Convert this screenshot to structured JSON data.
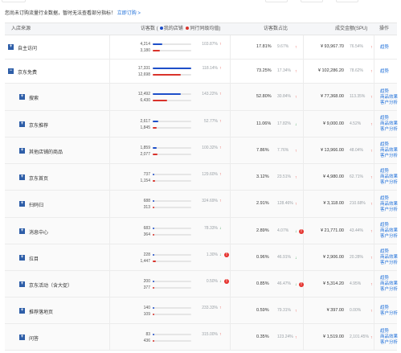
{
  "notice": {
    "text": "您尚未订购流量行业数据，暂时无法查看部分指标！",
    "link": "立即订购 >"
  },
  "colors": {
    "mine": "#1e4fc9",
    "peer": "#d9332b",
    "link": "#1e6fd9",
    "up": "#e5322d",
    "down": "#2b9a4a"
  },
  "header": {
    "source": "入店来源",
    "visitors": "访客数",
    "legend_mine": "我的店铺",
    "legend_peer": "同行同级均值",
    "share": "访客数占比",
    "amount": "成交金额(SPU)",
    "op": "操作"
  },
  "rows": [
    {
      "name": "自主访问",
      "level": 1,
      "expand": "+",
      "mine": "4,214",
      "mine_frac": 0.24,
      "peer": "3,180",
      "peer_frac": 0.18,
      "change": "103.87%",
      "dir": "up",
      "share": "17.81%",
      "share_sub": "9.67%",
      "share_dir": "up",
      "amount": "¥ 93,967.70",
      "amount_sub": "76.54%",
      "amount_dir": "up",
      "ops": [
        "趋势"
      ]
    },
    {
      "name": "京东免费",
      "level": 1,
      "expand": "−",
      "mine": "17,331",
      "mine_frac": 1.0,
      "peer": "12,698",
      "peer_frac": 0.73,
      "change": "118.14%",
      "dir": "up",
      "share": "73.25%",
      "share_sub": "17.34%",
      "share_dir": "up",
      "amount": "¥ 102,286.20",
      "amount_sub": "78.62%",
      "amount_dir": "up",
      "ops": [
        "趋势"
      ]
    },
    {
      "name": "搜索",
      "level": 2,
      "expand": "+",
      "mine": "12,492",
      "mine_frac": 0.72,
      "peer": "6,430",
      "peer_frac": 0.37,
      "change": "143.22%",
      "dir": "up",
      "share": "52.80%",
      "share_sub": "30.84%",
      "share_dir": "up",
      "amount": "¥ 77,368.00",
      "amount_sub": "113.35%",
      "amount_dir": "up",
      "ops": [
        "趋势",
        "商品效果",
        "客户分析"
      ]
    },
    {
      "name": "京东推荐",
      "level": 2,
      "expand": "+",
      "mine": "2,617",
      "mine_frac": 0.15,
      "peer": "1,845",
      "peer_frac": 0.11,
      "change": "52.77%",
      "dir": "up",
      "share": "11.06%",
      "share_sub": "17.82%",
      "share_dir": "down",
      "amount": "¥ 9,000.00",
      "amount_sub": "4.52%",
      "amount_dir": "up",
      "ops": [
        "趋势",
        "商品效果",
        "客户分析"
      ]
    },
    {
      "name": "其他店铺的商品",
      "level": 2,
      "expand": "+",
      "mine": "1,859",
      "mine_frac": 0.11,
      "peer": "2,077",
      "peer_frac": 0.12,
      "change": "100.32%",
      "dir": "up",
      "share": "7.86%",
      "share_sub": "7.76%",
      "share_dir": "up",
      "amount": "¥ 13,966.00",
      "amount_sub": "48.04%",
      "amount_dir": "up",
      "ops": [
        "趋势",
        "商品效果",
        "客户分析"
      ]
    },
    {
      "name": "京东首页",
      "level": 2,
      "expand": "+",
      "mine": "737",
      "mine_frac": 0.043,
      "peer": "1,154",
      "peer_frac": 0.067,
      "change": "129.60%",
      "dir": "up",
      "share": "3.12%",
      "share_sub": "23.51%",
      "share_dir": "up",
      "amount": "¥ 4,980.00",
      "amount_sub": "62.71%",
      "amount_dir": "up",
      "ops": [
        "趋势",
        "商品效果",
        "客户分析"
      ]
    },
    {
      "name": "扫码归",
      "level": 2,
      "expand": "+",
      "mine": "688",
      "mine_frac": 0.04,
      "peer": "313",
      "peer_frac": 0.018,
      "change": "324.69%",
      "dir": "up",
      "share": "2.91%",
      "share_sub": "128.46%",
      "share_dir": "up",
      "amount": "¥ 3,118.00",
      "amount_sub": "210.68%",
      "amount_dir": "up",
      "ops": [
        "趋势",
        "商品效果",
        "客户分析"
      ]
    },
    {
      "name": "消息中心",
      "level": 2,
      "expand": "+",
      "mine": "683",
      "mine_frac": 0.039,
      "peer": "364",
      "peer_frac": 0.021,
      "change": "78.33%",
      "dir": "down",
      "share": "2.89%",
      "share_sub": "4.07%",
      "share_dir": "down",
      "share_warn": true,
      "amount": "¥ 21,771.00",
      "amount_sub": "43.44%",
      "amount_dir": "up",
      "ops": [
        "趋势",
        "商品效果",
        "客户分析"
      ]
    },
    {
      "name": "拉目",
      "level": 2,
      "expand": "+",
      "mine": "228",
      "mine_frac": 0.013,
      "peer": "1,447",
      "peer_frac": 0.083,
      "change": "1.30%",
      "dir": "down",
      "warn": true,
      "share": "0.96%",
      "share_sub": "46.91%",
      "share_dir": "down",
      "amount": "¥ 2,906.00",
      "amount_sub": "20.28%",
      "amount_dir": "up",
      "ops": [
        "趋势",
        "商品效果",
        "客户分析"
      ]
    },
    {
      "name": "京东活动（含大促）",
      "level": 2,
      "expand": "+",
      "mine": "200",
      "mine_frac": 0.012,
      "peer": "377",
      "peer_frac": 0.022,
      "change": "0.50%",
      "dir": "down",
      "warn": true,
      "share": "0.85%",
      "share_sub": "46.47%",
      "share_dir": "down",
      "share_warn": true,
      "amount": "¥ 5,314.20",
      "amount_sub": "4.95%",
      "amount_dir": "up",
      "ops": [
        "趋势",
        "商品效果",
        "客户分析"
      ]
    },
    {
      "name": "推荐落地页",
      "level": 2,
      "expand": "+",
      "mine": "140",
      "mine_frac": 0.008,
      "peer": "109",
      "peer_frac": 0.006,
      "change": "233.33%",
      "dir": "up",
      "share": "0.59%",
      "share_sub": "79.31%",
      "share_dir": "up",
      "amount": "¥ 397.00",
      "amount_sub": "0.00%",
      "amount_dir": "up",
      "ops": [
        "趋势",
        "客户分析"
      ]
    },
    {
      "name": "问答",
      "level": 2,
      "expand": "+",
      "mine": "83",
      "mine_frac": 0.005,
      "peer": "436",
      "peer_frac": 0.025,
      "change": "315.00%",
      "dir": "up",
      "share": "0.35%",
      "share_sub": "123.24%",
      "share_dir": "up",
      "amount": "¥ 1,519.00",
      "amount_sub": "2,101.45%",
      "amount_dir": "up",
      "ops": [
        "趋势",
        "商品效果",
        "客户分析"
      ]
    }
  ]
}
